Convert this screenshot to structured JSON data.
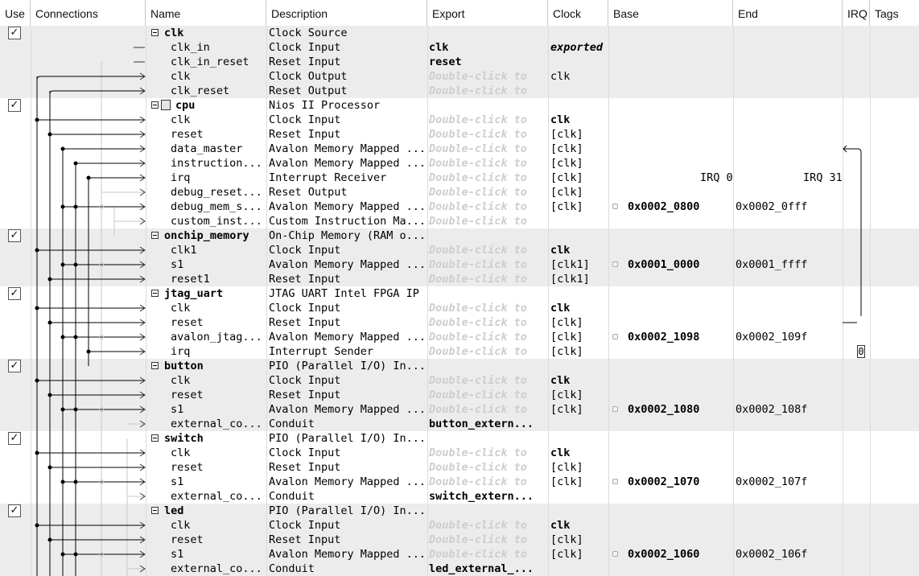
{
  "headers": {
    "use": "Use",
    "connections": "Connections",
    "name": "Name",
    "description": "Description",
    "export": "Export",
    "clock": "Clock",
    "base": "Base",
    "end": "End",
    "irq": "IRQ",
    "tags": "Tags"
  },
  "hint": "Double-click to",
  "components": [
    {
      "name": "clk",
      "description": "Clock Source",
      "checked": true,
      "icon": null,
      "interfaces": [
        {
          "name": "clk_in",
          "description": "Clock Input",
          "export": "clk",
          "clock": "exported"
        },
        {
          "name": "clk_in_reset",
          "description": "Reset Input",
          "export": "reset",
          "clock": ""
        },
        {
          "name": "clk",
          "description": "Clock Output",
          "export": "",
          "clock": "clk"
        },
        {
          "name": "clk_reset",
          "description": "Reset Output",
          "export": "",
          "clock": ""
        }
      ]
    },
    {
      "name": "cpu",
      "description": "Nios II Processor",
      "checked": true,
      "icon": "processor-icon",
      "interfaces": [
        {
          "name": "clk",
          "description": "Clock Input",
          "export": "",
          "clock": "clk"
        },
        {
          "name": "reset",
          "description": "Reset Input",
          "export": "",
          "clock": "[clk]"
        },
        {
          "name": "data_master",
          "description": "Avalon Memory Mapped ...",
          "export": "",
          "clock": "[clk]"
        },
        {
          "name": "instruction...",
          "description": "Avalon Memory Mapped ...",
          "export": "",
          "clock": "[clk]"
        },
        {
          "name": "irq",
          "description": "Interrupt Receiver",
          "export": "",
          "clock": "[clk]",
          "irq_from": "IRQ 0",
          "irq_to": "IRQ 31"
        },
        {
          "name": "debug_reset...",
          "description": "Reset Output",
          "export": "",
          "clock": "[clk]"
        },
        {
          "name": "debug_mem_s...",
          "description": "Avalon Memory Mapped ...",
          "export": "",
          "clock": "[clk]",
          "base": "0x0002_0800",
          "end": "0x0002_0fff"
        },
        {
          "name": "custom_inst...",
          "description": "Custom Instruction Ma...",
          "export": "",
          "clock": ""
        }
      ]
    },
    {
      "name": "onchip_memory",
      "description": "On-Chip Memory (RAM o...",
      "checked": true,
      "icon": null,
      "interfaces": [
        {
          "name": "clk1",
          "description": "Clock Input",
          "export": "",
          "clock": "clk"
        },
        {
          "name": "s1",
          "description": "Avalon Memory Mapped ...",
          "export": "",
          "clock": "[clk1]",
          "base": "0x0001_0000",
          "end": "0x0001_ffff"
        },
        {
          "name": "reset1",
          "description": "Reset Input",
          "export": "",
          "clock": "[clk1]"
        }
      ]
    },
    {
      "name": "jtag_uart",
      "description": "JTAG UART Intel FPGA IP",
      "checked": true,
      "icon": null,
      "interfaces": [
        {
          "name": "clk",
          "description": "Clock Input",
          "export": "",
          "clock": "clk"
        },
        {
          "name": "reset",
          "description": "Reset Input",
          "export": "",
          "clock": "[clk]"
        },
        {
          "name": "avalon_jtag...",
          "description": "Avalon Memory Mapped ...",
          "export": "",
          "clock": "[clk]",
          "base": "0x0002_1098",
          "end": "0x0002_109f"
        },
        {
          "name": "irq",
          "description": "Interrupt Sender",
          "export": "",
          "clock": "[clk]",
          "irq_num": "0"
        }
      ]
    },
    {
      "name": "button",
      "description": "PIO (Parallel I/O) In...",
      "checked": true,
      "icon": null,
      "interfaces": [
        {
          "name": "clk",
          "description": "Clock Input",
          "export": "",
          "clock": "clk"
        },
        {
          "name": "reset",
          "description": "Reset Input",
          "export": "",
          "clock": "[clk]"
        },
        {
          "name": "s1",
          "description": "Avalon Memory Mapped ...",
          "export": "",
          "clock": "[clk]",
          "base": "0x0002_1080",
          "end": "0x0002_108f"
        },
        {
          "name": "external_co...",
          "description": "Conduit",
          "export": "button_extern...",
          "clock": ""
        }
      ]
    },
    {
      "name": "switch",
      "description": "PIO (Parallel I/O) In...",
      "checked": true,
      "icon": null,
      "interfaces": [
        {
          "name": "clk",
          "description": "Clock Input",
          "export": "",
          "clock": "clk"
        },
        {
          "name": "reset",
          "description": "Reset Input",
          "export": "",
          "clock": "[clk]"
        },
        {
          "name": "s1",
          "description": "Avalon Memory Mapped ...",
          "export": "",
          "clock": "[clk]",
          "base": "0x0002_1070",
          "end": "0x0002_107f"
        },
        {
          "name": "external_co...",
          "description": "Conduit",
          "export": "switch_extern...",
          "clock": ""
        }
      ]
    },
    {
      "name": "led",
      "description": "PIO (Parallel I/O) In...",
      "checked": true,
      "icon": null,
      "interfaces": [
        {
          "name": "clk",
          "description": "Clock Input",
          "export": "",
          "clock": "clk"
        },
        {
          "name": "reset",
          "description": "Reset Input",
          "export": "",
          "clock": "[clk]"
        },
        {
          "name": "s1",
          "description": "Avalon Memory Mapped ...",
          "export": "",
          "clock": "[clk]",
          "base": "0x0002_1060",
          "end": "0x0002_106f"
        },
        {
          "name": "external_co...",
          "description": "Conduit",
          "export": "led_external_...",
          "clock": ""
        }
      ]
    }
  ]
}
